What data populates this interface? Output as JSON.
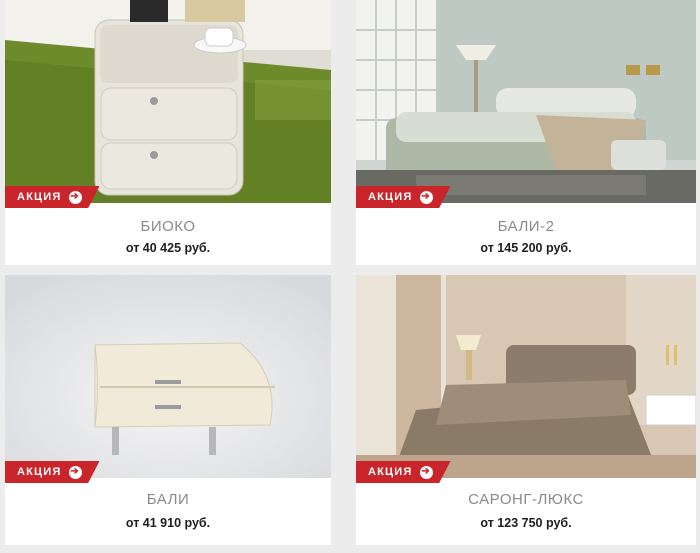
{
  "promo_badge": "АКЦИЯ",
  "products": [
    {
      "name": "БИОКО",
      "price": "от 40 425 руб."
    },
    {
      "name": "БАЛИ-2",
      "price": "от 145 200 руб."
    },
    {
      "name": "БАЛИ",
      "price": "от 41 910 руб."
    },
    {
      "name": "САРОНГ-ЛЮКС",
      "price": "от 123 750 руб."
    }
  ],
  "colors": {
    "badge_red": "#c9252b",
    "title_gray": "#8a8a8a",
    "price_dark": "#1e1e1e",
    "background": "#ececec"
  },
  "icons": {
    "badge_arrow": "arrow-right-circle-icon"
  }
}
